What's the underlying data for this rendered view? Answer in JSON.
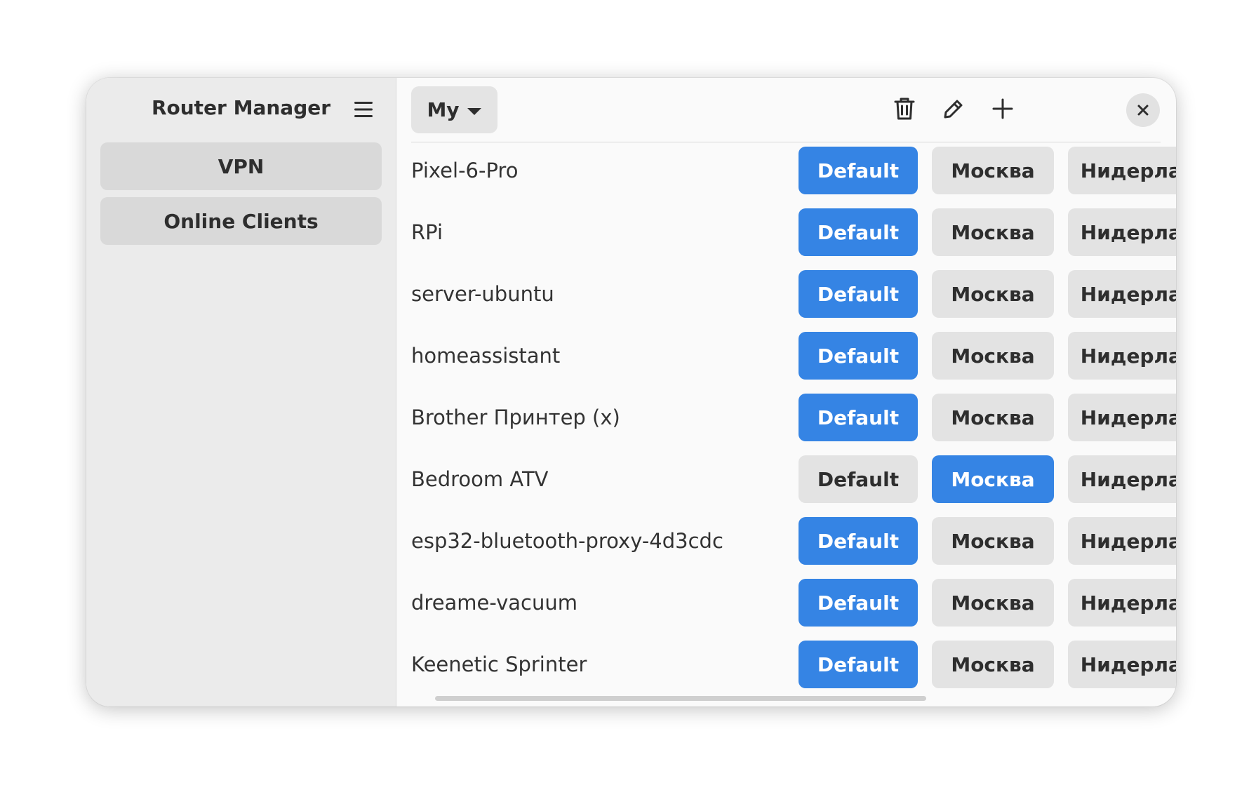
{
  "app": {
    "title": "Router Manager"
  },
  "sidebar": {
    "items": [
      {
        "label": "VPN"
      },
      {
        "label": "Online Clients"
      }
    ]
  },
  "toolbar": {
    "profile_label": "My",
    "icons": [
      "trash-icon",
      "pencil-icon",
      "plus-icon",
      "close-icon"
    ]
  },
  "options": {
    "default": "Default",
    "moscow": "Москва",
    "netherlands": "Нидерланды"
  },
  "clients": [
    {
      "name": "Pixel-6-Pro",
      "selected": "Default"
    },
    {
      "name": "RPi",
      "selected": "Default"
    },
    {
      "name": "server-ubuntu",
      "selected": "Default"
    },
    {
      "name": "homeassistant",
      "selected": "Default"
    },
    {
      "name": "Brother Принтер (x)",
      "selected": "Default"
    },
    {
      "name": "Bedroom ATV",
      "selected": "Москва"
    },
    {
      "name": "esp32-bluetooth-proxy-4d3cdc",
      "selected": "Default"
    },
    {
      "name": "dreame-vacuum",
      "selected": "Default"
    },
    {
      "name": "Keenetic Sprinter",
      "selected": "Default"
    }
  ],
  "colors": {
    "accent": "#3584e4",
    "button_bg": "#e3e3e3",
    "sidebar_bg": "#ebebeb",
    "content_bg": "#fafafa"
  }
}
